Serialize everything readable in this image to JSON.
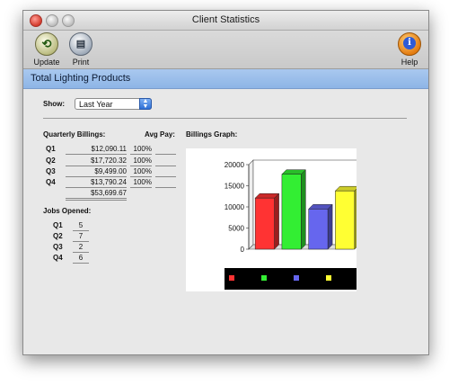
{
  "window": {
    "title": "Client Statistics"
  },
  "toolbar": {
    "update_label": "Update",
    "print_label": "Print",
    "help_label": "Help",
    "help_glyph": "i",
    "update_icon": "update-refresh-icon",
    "print_icon": "printer-icon",
    "help_icon": "info-icon"
  },
  "section": {
    "title": "Total Lighting Products"
  },
  "filter": {
    "show_label": "Show:",
    "show_value": "Last Year"
  },
  "billings": {
    "heading": "Quarterly Billings:",
    "avg_pay_heading": "Avg Pay:",
    "rows": [
      {
        "quarter": "Q1",
        "amount": "$12,090.11",
        "avg_pay": "100%"
      },
      {
        "quarter": "Q2",
        "amount": "$17,720.32",
        "avg_pay": "100%"
      },
      {
        "quarter": "Q3",
        "amount": "$9,499.00",
        "avg_pay": "100%"
      },
      {
        "quarter": "Q4",
        "amount": "$13,790.24",
        "avg_pay": "100%"
      }
    ],
    "total": "$53,699.67"
  },
  "jobs": {
    "heading": "Jobs Opened:",
    "rows": [
      {
        "quarter": "Q1",
        "count": "5"
      },
      {
        "quarter": "Q2",
        "count": "7"
      },
      {
        "quarter": "Q3",
        "count": "2"
      },
      {
        "quarter": "Q4",
        "count": "6"
      }
    ]
  },
  "graph": {
    "heading": "Billings Graph:"
  },
  "chart_data": {
    "type": "bar",
    "categories": [
      "Q1",
      "Q2",
      "Q3",
      "Q4"
    ],
    "values": [
      12090.11,
      17720.32,
      9499.0,
      13790.24
    ],
    "colors": [
      "#ff3333",
      "#33ee33",
      "#6666ee",
      "#ffff33"
    ],
    "ylim": [
      0,
      20000
    ],
    "yticks": [
      0,
      5000,
      10000,
      15000,
      20000
    ],
    "title": "",
    "xlabel": "",
    "ylabel": "",
    "grid": false,
    "legend": "bottom"
  },
  "colors": {
    "header_bg": "#97bde9",
    "window_bg": "#e8e8e8"
  }
}
